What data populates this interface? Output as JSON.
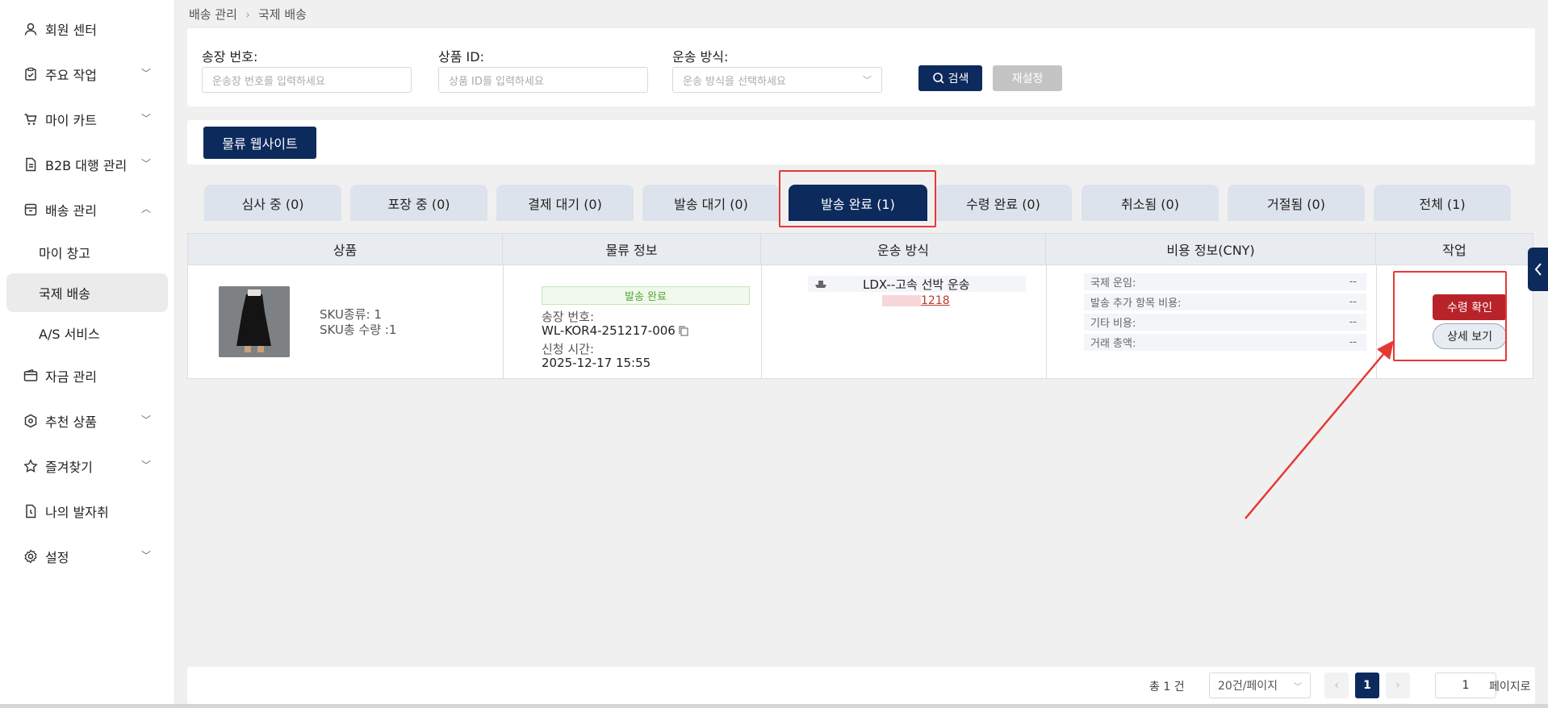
{
  "sidebar": {
    "items": [
      {
        "label": "회원 센터",
        "icon": "user-icon"
      },
      {
        "label": "주요 작업",
        "icon": "clipboard-icon"
      },
      {
        "label": "마이 카트",
        "icon": "cart-icon"
      },
      {
        "label": "B2B 대행 관리",
        "icon": "document-icon"
      },
      {
        "label": "배송 관리",
        "icon": "box-icon"
      },
      {
        "label": "자금 관리",
        "icon": "wallet-icon"
      },
      {
        "label": "추천 상품",
        "icon": "gear-badge-icon"
      },
      {
        "label": "즐겨찾기",
        "icon": "star-icon"
      },
      {
        "label": "나의 발자취",
        "icon": "footprint-icon"
      },
      {
        "label": "설정",
        "icon": "settings-icon"
      }
    ],
    "sub_items": [
      "마이 창고",
      "국제 배송",
      "A/S 서비스"
    ]
  },
  "breadcrumb": {
    "parent": "배송 관리",
    "current": "국제 배송"
  },
  "search": {
    "invoice_label": "송장 번호:",
    "invoice_placeholder": "운송장 번호를 입력하세요",
    "product_label": "상품 ID:",
    "product_placeholder": "상품 ID를 입력하세요",
    "method_label": "운송 방식:",
    "method_placeholder": "운송 방식을 선택하세요",
    "search_button": "검색",
    "reset_button": "재설정"
  },
  "logistics_button": "물류 웹사이트",
  "tabs": [
    {
      "label": "심사 중 (0)"
    },
    {
      "label": "포장 중 (0)"
    },
    {
      "label": "결제 대기 (0)"
    },
    {
      "label": "발송 대기 (0)"
    },
    {
      "label": "발송 완료 (1)"
    },
    {
      "label": "수령 완료 (0)"
    },
    {
      "label": "취소됨 (0)"
    },
    {
      "label": "거절됨 (0)"
    },
    {
      "label": "전체 (1)"
    }
  ],
  "table": {
    "headers": [
      "상품",
      "물류 정보",
      "운송 방식",
      "비용 정보(CNY)",
      "작업"
    ],
    "row": {
      "sku_kind": "SKU종류: 1",
      "sku_qty": "SKU총 수량 :1",
      "status": "발송 완료",
      "invoice_label": "송장 번호:",
      "invoice_value": "WL-KOR4-251217-006",
      "time_label": "신청 시간:",
      "time_value": "2025-12-17 15:55",
      "shipping_method": "LDX--고속 선박 운송",
      "tracking": "1218",
      "costs": [
        {
          "label": "국제 운임:",
          "value": "--"
        },
        {
          "label": "발송 추가 항목 비용:",
          "value": "--"
        },
        {
          "label": "기타 비용:",
          "value": "--"
        },
        {
          "label": "거래 총액:",
          "value": "--"
        }
      ],
      "confirm_button": "수령 확인",
      "detail_button": "상세 보기"
    }
  },
  "pagination": {
    "total": "총 1 건",
    "page_size": "20건/페이지",
    "current_page": "1",
    "goto_value": "1",
    "goto_label": "페이지로"
  },
  "colors": {
    "primary": "#0d2a5c",
    "danger": "#b8232a",
    "highlight": "#e53935",
    "success": "#52a535"
  }
}
